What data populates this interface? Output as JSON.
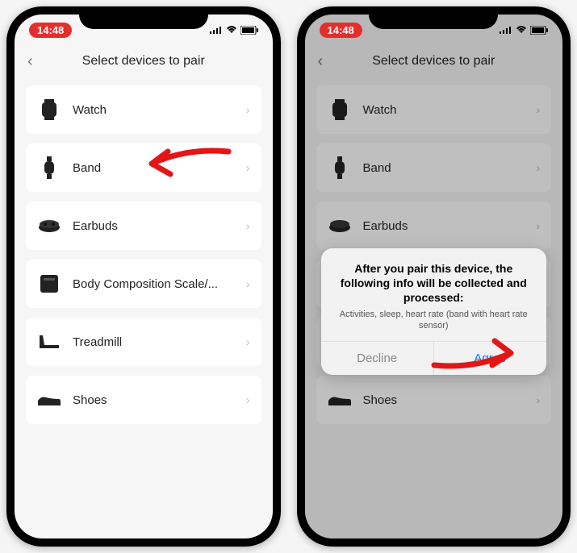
{
  "status": {
    "time": "14:48"
  },
  "header": {
    "title": "Select devices to pair"
  },
  "devices": [
    {
      "label": "Watch"
    },
    {
      "label": "Band"
    },
    {
      "label": "Earbuds"
    },
    {
      "label": "Body Composition Scale/..."
    },
    {
      "label": "Treadmill"
    },
    {
      "label": "Shoes"
    }
  ],
  "dialog": {
    "title": "After you pair this device, the following info will be collected and processed:",
    "subtitle": "Activities, sleep, heart rate (band with heart rate sensor)",
    "decline": "Decline",
    "agree": "Agree"
  }
}
